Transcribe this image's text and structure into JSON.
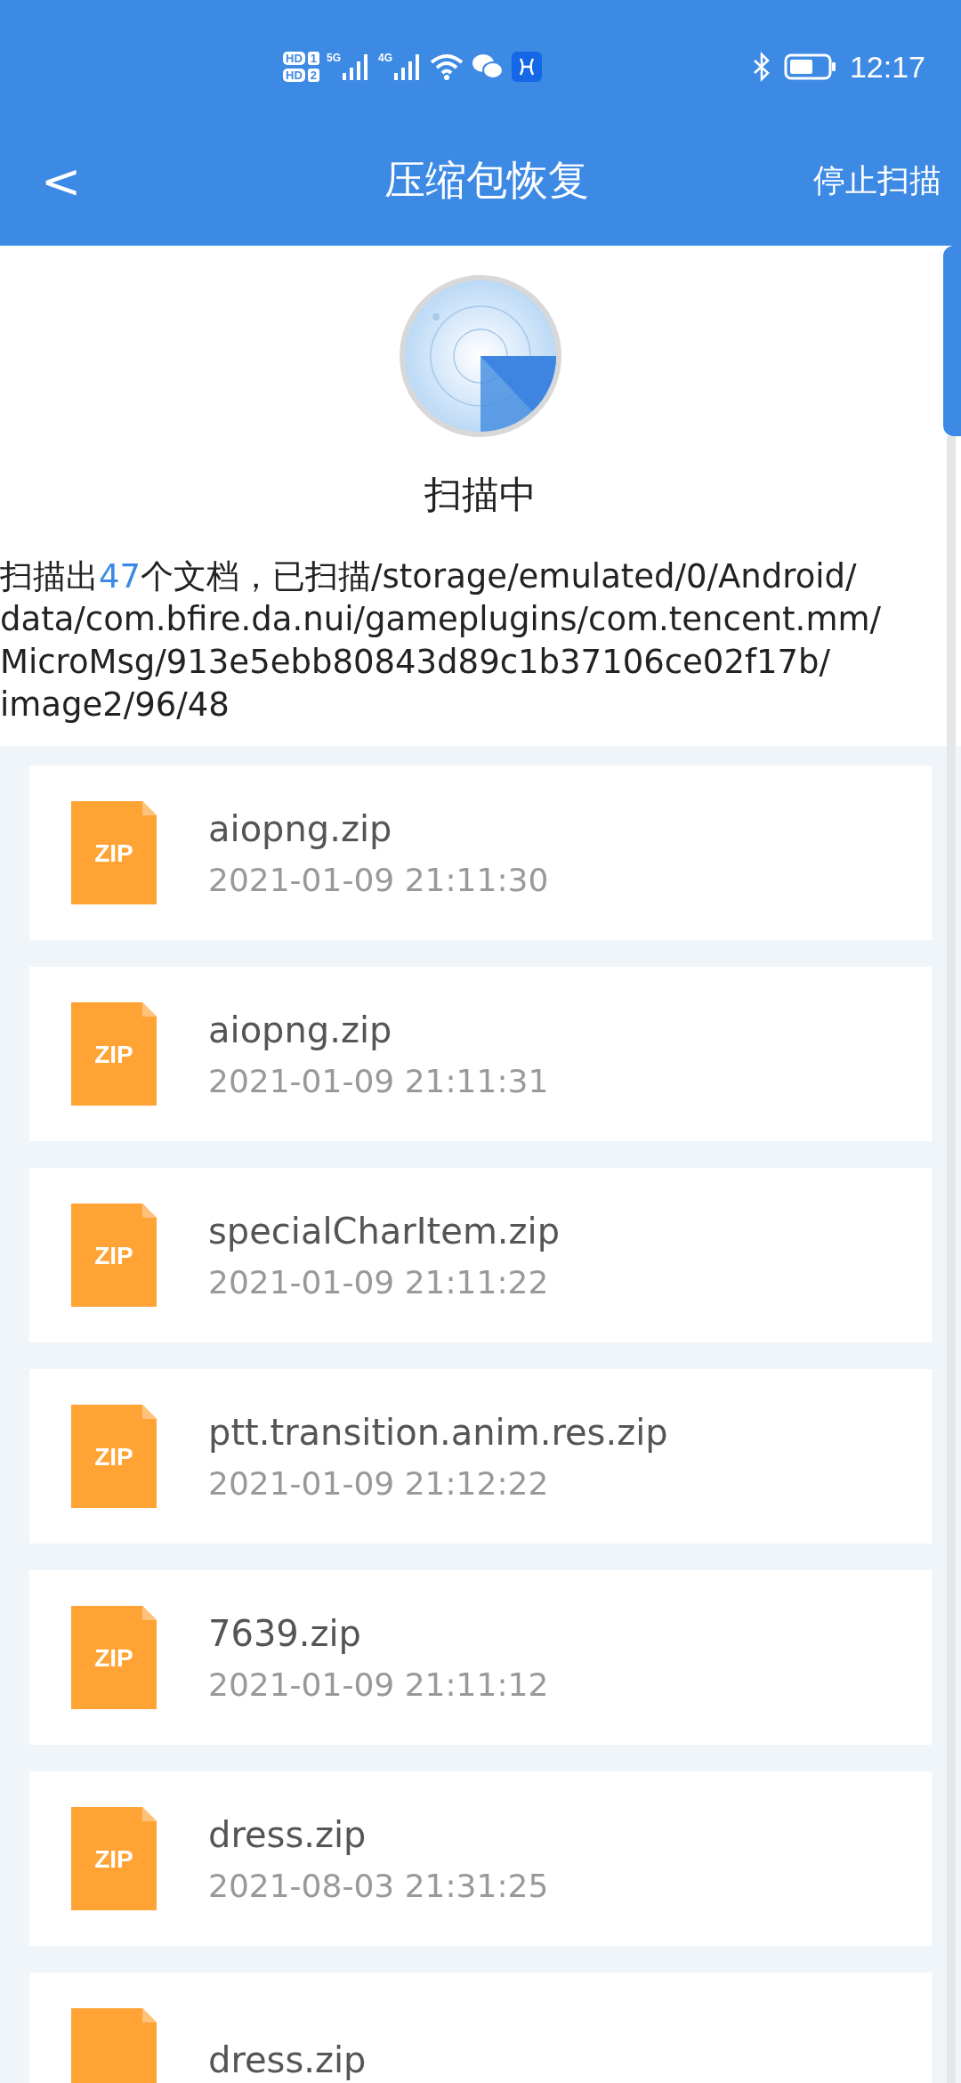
{
  "status_bar": {
    "sims": [
      {
        "hd": "HD",
        "slot": "1"
      },
      {
        "hd": "HD",
        "slot": "2"
      }
    ],
    "networks": [
      "5G",
      "4G"
    ],
    "time": "12:17"
  },
  "header": {
    "back": "<",
    "title": "压缩包恢复",
    "action": "停止扫描"
  },
  "scan": {
    "status": "扫描中",
    "count_prefix": "扫描出",
    "count": "47",
    "count_suffix": "个文档，已扫描",
    "path": "/storage/emulated/0/Android/data/com.bfire.da.nui/gameplugins/com.tencent.mm/MicroMsg/913e5ebb80843d89c1b37106ce02f17b/image2/96/48"
  },
  "files": [
    {
      "badge": "ZIP",
      "name": "aiopng.zip",
      "date": "2021-01-09 21:11:30"
    },
    {
      "badge": "ZIP",
      "name": "aiopng.zip",
      "date": "2021-01-09 21:11:31"
    },
    {
      "badge": "ZIP",
      "name": "specialCharItem.zip",
      "date": "2021-01-09 21:11:22"
    },
    {
      "badge": "ZIP",
      "name": "ptt.transition.anim.res.zip",
      "date": "2021-01-09 21:12:22"
    },
    {
      "badge": "ZIP",
      "name": "7639.zip",
      "date": "2021-01-09 21:11:12"
    },
    {
      "badge": "ZIP",
      "name": "dress.zip",
      "date": "2021-08-03 21:31:25"
    },
    {
      "name": "dress.zip"
    }
  ]
}
